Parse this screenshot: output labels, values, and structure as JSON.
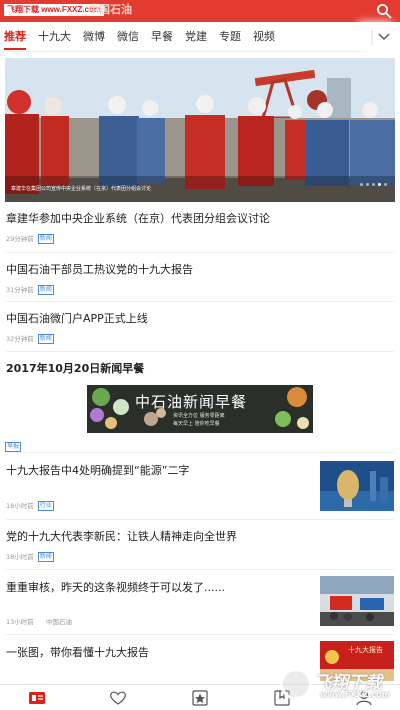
{
  "header": {
    "watermark": "飞翔下载 www.FXXZ.com",
    "app_title": "中国石油"
  },
  "tabs": [
    {
      "label": "推荐"
    },
    {
      "label": "十九大"
    },
    {
      "label": "微博"
    },
    {
      "label": "微信"
    },
    {
      "label": "早餐"
    },
    {
      "label": "党建"
    },
    {
      "label": "专题"
    },
    {
      "label": "视频"
    }
  ],
  "banner": {
    "caption": "章建华在集团公司宣传中央企业系统（在京）代表团分组会讨论",
    "page_count": 5,
    "active_page": 4
  },
  "news": [
    {
      "title": "章建华参加中央企业系统（在京）代表团分组会议讨论",
      "time": "29分钟前",
      "tag": "新闻"
    },
    {
      "title": "中国石油干部员工热议党的十九大报告",
      "time": "31分钟前",
      "tag": "新闻"
    },
    {
      "title": "中国石油微门户APP正式上线",
      "time": "32分钟前",
      "tag": "新闻"
    },
    {
      "title": "十九大报告中4处明确提到“能源”二字",
      "time": "18小时前",
      "tag": "行业"
    },
    {
      "title": "党的十九大代表李新民：让铁人精神走向全世界",
      "time": "18小时前",
      "tag": "新闻"
    },
    {
      "title": "重重审核，昨天的这条视频终于可以发了......",
      "time": "13小时前",
      "source": "中国石油"
    },
    {
      "title": "一张图，带你看懂十九大报告",
      "thumb_text": "十九大报告"
    }
  ],
  "breakfast": {
    "section_title": "2017年10月20日新闻早餐",
    "image_title": "中石油新闻早餐",
    "image_line1": "资讯全方位 服务零距离",
    "image_line2": "每天早上 陪你吃早餐",
    "tag": "早报"
  },
  "overlay": {
    "brand": "飞翔下载",
    "url": "www.FXXZ.com"
  },
  "colors": {
    "brand_red": "#e23b30",
    "active_tab": "#d8261c",
    "tag_blue": "#4a8fd6"
  }
}
